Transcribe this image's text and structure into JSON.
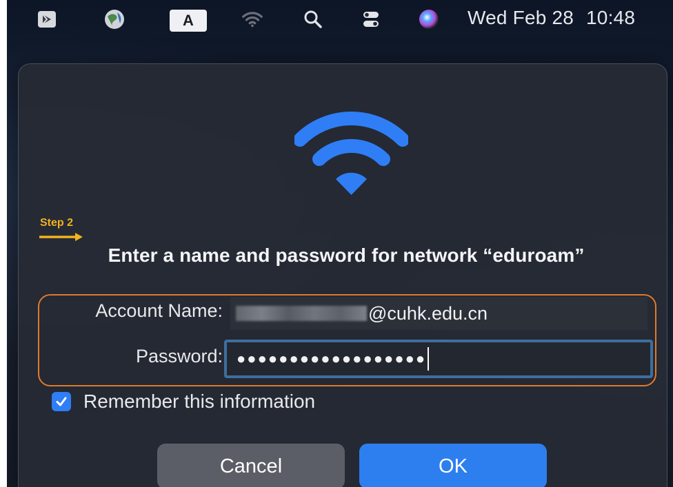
{
  "menubar": {
    "icons": [
      "screen-share-icon",
      "globe-icon",
      "input-source-icon",
      "wifi-icon",
      "spotlight-search-icon",
      "control-center-icon",
      "siri-icon"
    ],
    "input_source_letter": "A",
    "date": "Wed Feb 28",
    "time": "10:48"
  },
  "annotation": {
    "step_label": "Step 2",
    "accent_color": "#f2b31c",
    "highlight_color": "#e07b2a"
  },
  "dialog": {
    "title": "Enter a name and password for network “eduroam”",
    "account_label": "Account Name:",
    "account_value_suffix": "@cuhk.edu.cn",
    "password_label": "Password:",
    "password_value": "●●●●●●●●●●●●●●●●●●",
    "remember_label": "Remember this information",
    "remember_checked": true,
    "cancel_label": "Cancel",
    "ok_label": "OK",
    "accent_color": "#2d7ff0"
  }
}
